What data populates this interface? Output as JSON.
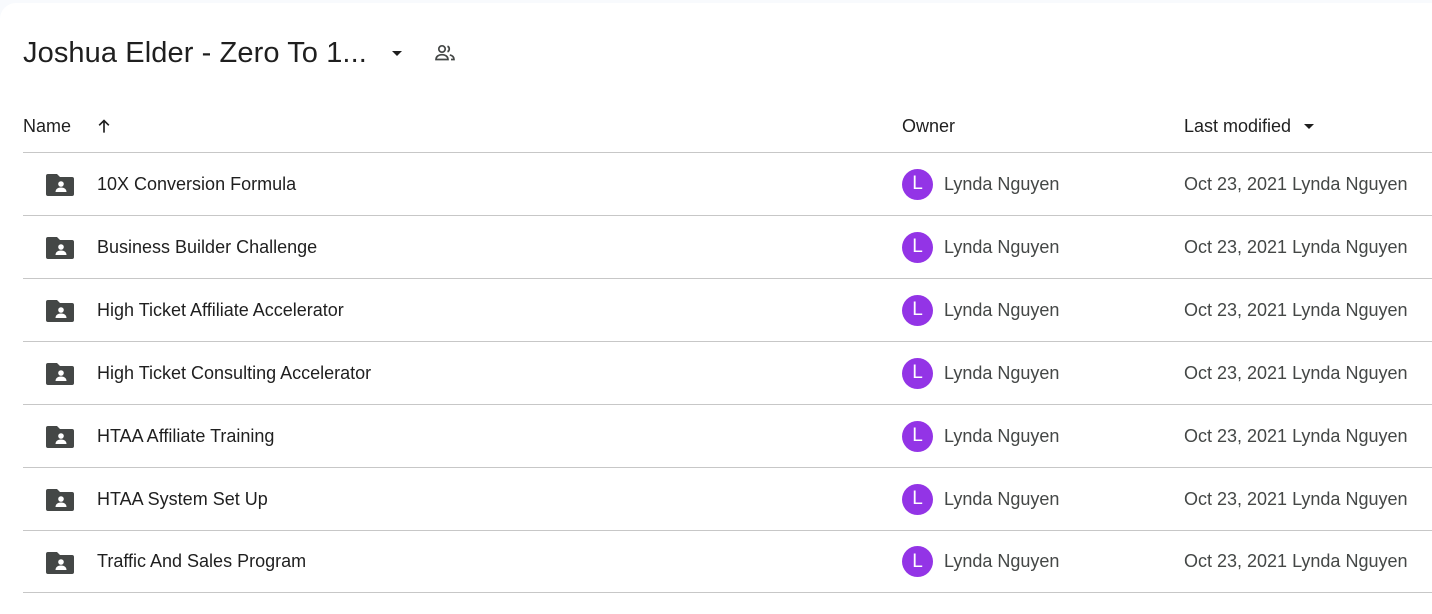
{
  "folder": {
    "title": "Joshua Elder - Zero To 1...",
    "dropdown_icon": "arrow-drop-down-icon",
    "shared_icon": "people-icon"
  },
  "columns": {
    "name": "Name",
    "owner": "Owner",
    "last_modified": "Last modified",
    "sort_icon": "arrow-upward-icon",
    "modified_sort_icon": "arrow-drop-down-icon"
  },
  "rows": [
    {
      "name": "10X Conversion Formula",
      "avatar_letter": "L",
      "owner": "Lynda Nguyen",
      "modified": "Oct 23, 2021 Lynda Nguyen"
    },
    {
      "name": "Business Builder Challenge",
      "avatar_letter": "L",
      "owner": "Lynda Nguyen",
      "modified": "Oct 23, 2021 Lynda Nguyen"
    },
    {
      "name": "High Ticket Affiliate Accelerator",
      "avatar_letter": "L",
      "owner": "Lynda Nguyen",
      "modified": "Oct 23, 2021 Lynda Nguyen"
    },
    {
      "name": "High Ticket Consulting Accelerator",
      "avatar_letter": "L",
      "owner": "Lynda Nguyen",
      "modified": "Oct 23, 2021 Lynda Nguyen"
    },
    {
      "name": "HTAA Affiliate Training",
      "avatar_letter": "L",
      "owner": "Lynda Nguyen",
      "modified": "Oct 23, 2021 Lynda Nguyen"
    },
    {
      "name": "HTAA System Set Up",
      "avatar_letter": "L",
      "owner": "Lynda Nguyen",
      "modified": "Oct 23, 2021 Lynda Nguyen"
    },
    {
      "name": "Traffic And Sales Program",
      "avatar_letter": "L",
      "owner": "Lynda Nguyen",
      "modified": "Oct 23, 2021 Lynda Nguyen"
    }
  ],
  "colors": {
    "avatar": "#9334e6",
    "folder_icon": "#444746",
    "divider": "#c7c7c7"
  }
}
